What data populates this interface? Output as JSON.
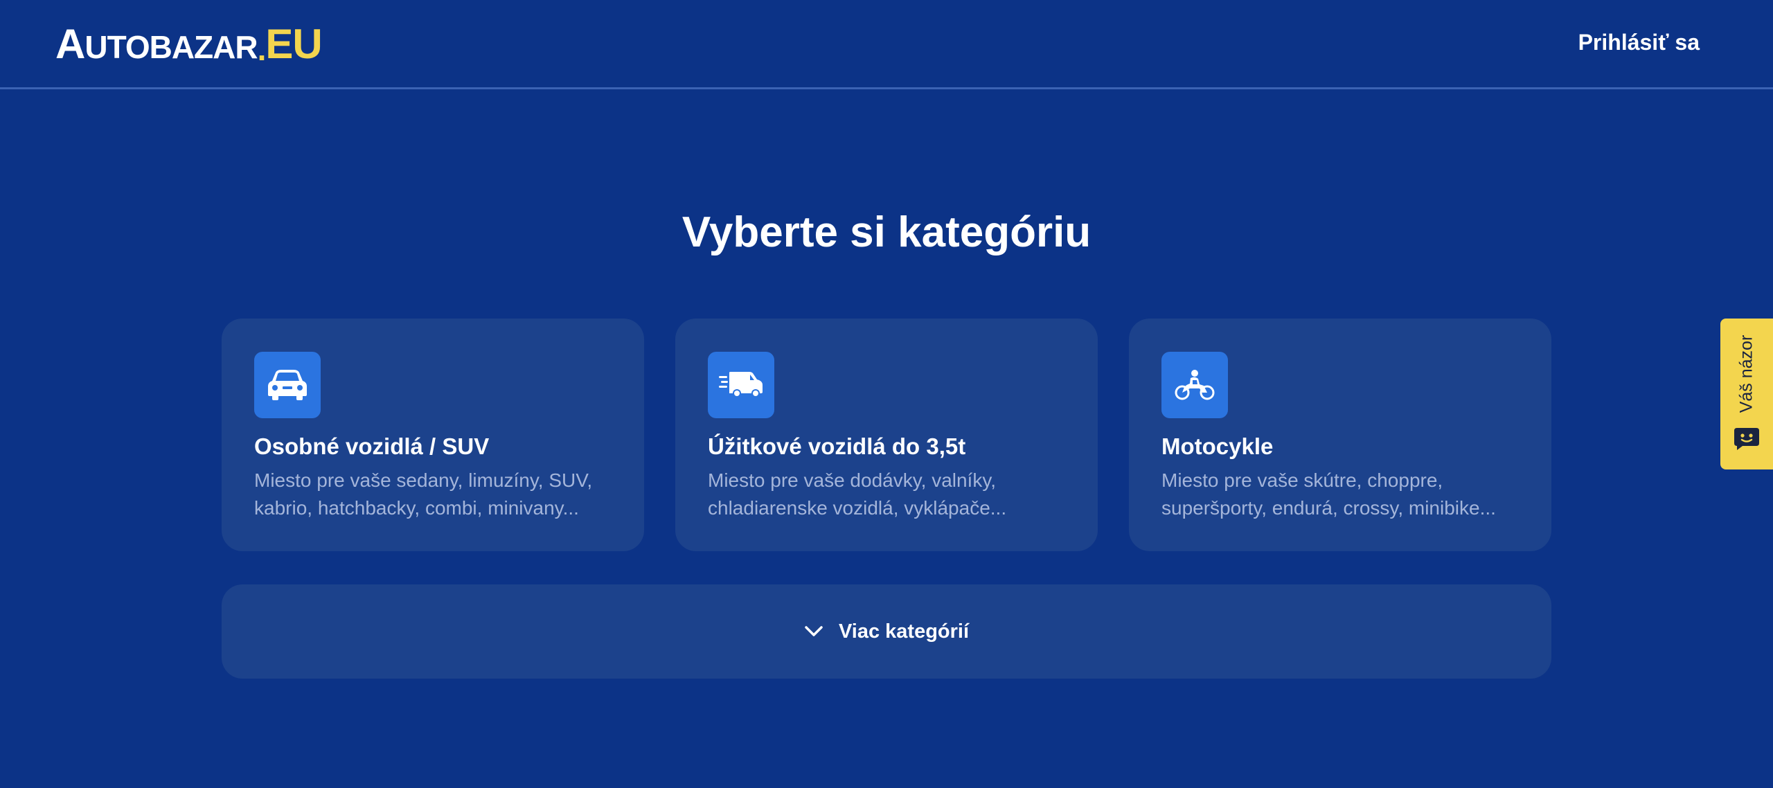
{
  "header": {
    "logo": {
      "main": "UTOBAZAR",
      "initial": "A",
      "dot": ".",
      "suffix": "EU"
    },
    "login_label": "Prihlásiť sa"
  },
  "main": {
    "title": "Vyberte si kategóriu",
    "categories": [
      {
        "icon": "car-icon",
        "title": "Osobné vozidlá / SUV",
        "desc_line1": "Miesto pre vaše sedany, limuzíny, SUV,",
        "desc_line2": "kabrio, hatchbacky, combi, minivany..."
      },
      {
        "icon": "van-icon",
        "title": "Úžitkové vozidlá do 3,5t",
        "desc_line1": "Miesto pre vaše dodávky, valníky,",
        "desc_line2": "chladiarenske vozidlá, vyklápače..."
      },
      {
        "icon": "motorcycle-icon",
        "title": "Motocykle",
        "desc_line1": "Miesto pre vaše skútre, choppre,",
        "desc_line2": "superšporty, endurá, crossy, minibike..."
      }
    ],
    "more_label": "Viac kategórií"
  },
  "feedback": {
    "label": "Váš názor",
    "icon": "chat-icon"
  },
  "colors": {
    "background": "#0c3387",
    "card": "#1c428c",
    "icon_box": "#2b74e0",
    "accent_yellow": "#f3d54e",
    "muted_text": "#a4b5da"
  }
}
